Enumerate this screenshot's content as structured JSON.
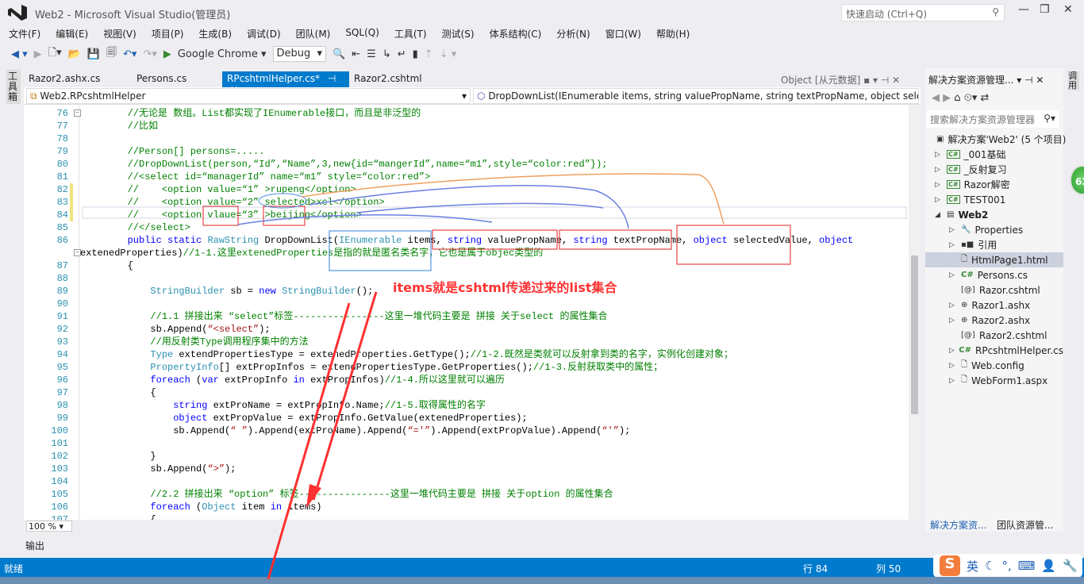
{
  "window": {
    "title": "Web2 - Microsoft Visual Studio(管理员)",
    "quick_launch": "快速启动 (Ctrl+Q)"
  },
  "menu": [
    "文件(F)",
    "编辑(E)",
    "视图(V)",
    "项目(P)",
    "生成(B)",
    "调试(D)",
    "团队(M)",
    "SQL(Q)",
    "工具(T)",
    "测试(S)",
    "体系结构(C)",
    "分析(N)",
    "窗口(W)",
    "帮助(H)"
  ],
  "toolbar": {
    "run_target": "Google Chrome",
    "config": "Debug"
  },
  "left_toolbox": "工具箱",
  "tabs": [
    {
      "label": "Razor2.ashx.cs",
      "active": false
    },
    {
      "label": "Persons.cs",
      "active": false
    },
    {
      "label": "RPcshtmlHelper.cs*",
      "active": true
    },
    {
      "label": "Razor2.cshtml",
      "active": false
    }
  ],
  "object_browser": "Object [从元数据]",
  "nav": {
    "class": "Web2.RPcshtmlHelper",
    "member": "DropDownList(IEnumerable items, string valuePropName, string textPropName, object selectedValue, object extenedProperties)"
  },
  "code": [
    {
      "n": "76",
      "fold": "-",
      "segs": [
        [
          "c",
          "        //无论是 数组。List都实现了IEnumerable接口，而且是非泛型的"
        ]
      ]
    },
    {
      "n": "77",
      "segs": [
        [
          "c",
          "        //比如"
        ]
      ]
    },
    {
      "n": "78",
      "segs": []
    },
    {
      "n": "79",
      "segs": [
        [
          "c",
          "        //Person[] persons=....."
        ]
      ]
    },
    {
      "n": "80",
      "segs": [
        [
          "c",
          "        //DropDownList(person,“Id”,“Name”,3,new{id=“mangerId”,name=“m1”,style=“color:red”});"
        ]
      ]
    },
    {
      "n": "81",
      "segs": [
        [
          "c",
          "        //<select id=“managerId” name=“m1” style=“color:red”>"
        ]
      ]
    },
    {
      "n": "82",
      "chg": true,
      "segs": [
        [
          "c",
          "        //    <option value=“1” >rupeng</option>"
        ]
      ]
    },
    {
      "n": "83",
      "chg": true,
      "segs": [
        [
          "c",
          "        //    <option value=“2” selected>xcl</option>"
        ]
      ]
    },
    {
      "n": "84",
      "chg": true,
      "segs": [
        [
          "c",
          "        //    <option vlaue=“3” >beijing</option>"
        ]
      ]
    },
    {
      "n": "85",
      "segs": [
        [
          "c",
          "        //</select>"
        ]
      ]
    },
    {
      "n": "86",
      "segs": [
        [
          "p",
          "        "
        ],
        [
          "k",
          "public static "
        ],
        [
          "t",
          "RawString"
        ],
        [
          "p",
          " DropDownList("
        ],
        [
          "t",
          "IEnumerable"
        ],
        [
          "p",
          " items, "
        ],
        [
          "k",
          "string"
        ],
        [
          "p",
          " valuePropName, "
        ],
        [
          "k",
          "string"
        ],
        [
          "p",
          " textPropName, "
        ],
        [
          "k",
          "object"
        ],
        [
          "p",
          " selectedValue, "
        ],
        [
          "k",
          "object"
        ]
      ]
    },
    {
      "n": "",
      "fold": "-",
      "wrap": true,
      "segs": [
        [
          "p",
          "extenedProperties)"
        ],
        [
          "c",
          "//1-1.这里extenedProperties是指的就是匿名类名字，它也是属于objec类型的"
        ]
      ]
    },
    {
      "n": "87",
      "segs": [
        [
          "p",
          "        {"
        ]
      ]
    },
    {
      "n": "88",
      "segs": []
    },
    {
      "n": "89",
      "segs": [
        [
          "p",
          "            "
        ],
        [
          "t",
          "StringBuilder"
        ],
        [
          "p",
          " sb = "
        ],
        [
          "k",
          "new "
        ],
        [
          "t",
          "StringBuilder"
        ],
        [
          "p",
          "();"
        ]
      ]
    },
    {
      "n": "90",
      "segs": []
    },
    {
      "n": "91",
      "segs": [
        [
          "c",
          "            //1.1 拼接出来 “select”标签----------------这里一堆代码主要是 拼接 关于select 的属性集合"
        ]
      ]
    },
    {
      "n": "92",
      "segs": [
        [
          "p",
          "            sb.Append("
        ],
        [
          "s",
          "“<select”"
        ],
        [
          "p",
          ");"
        ]
      ]
    },
    {
      "n": "93",
      "segs": [
        [
          "c",
          "            //用反射类Type调用程序集中的方法"
        ]
      ]
    },
    {
      "n": "94",
      "segs": [
        [
          "p",
          "            "
        ],
        [
          "t",
          "Type"
        ],
        [
          "p",
          " extendPropertiesType = extenedProperties.GetType();"
        ],
        [
          "c",
          "//1-2.既然是类就可以反射拿到类的名字，实例化创建对象；"
        ]
      ]
    },
    {
      "n": "95",
      "segs": [
        [
          "p",
          "            "
        ],
        [
          "t",
          "PropertyInfo"
        ],
        [
          "p",
          "[] extPropInfos = extendPropertiesType.GetProperties();"
        ],
        [
          "c",
          "//1-3.反射获取类中的属性；"
        ]
      ]
    },
    {
      "n": "96",
      "segs": [
        [
          "p",
          "            "
        ],
        [
          "k",
          "foreach"
        ],
        [
          "p",
          " ("
        ],
        [
          "k",
          "var"
        ],
        [
          "p",
          " extPropInfo "
        ],
        [
          "k",
          "in"
        ],
        [
          "p",
          " extPropInfos)"
        ],
        [
          "c",
          "//1-4.所以这里就可以遍历"
        ]
      ]
    },
    {
      "n": "97",
      "segs": [
        [
          "p",
          "            {"
        ]
      ]
    },
    {
      "n": "98",
      "segs": [
        [
          "p",
          "                "
        ],
        [
          "k",
          "string"
        ],
        [
          "p",
          " extProName = extPropInfo.Name;"
        ],
        [
          "c",
          "//1-5.取得属性的名字"
        ]
      ]
    },
    {
      "n": "99",
      "segs": [
        [
          "p",
          "                "
        ],
        [
          "k",
          "object"
        ],
        [
          "p",
          " extPropValue = extPropInfo.GetValue(extenedProperties);"
        ]
      ]
    },
    {
      "n": "100",
      "segs": [
        [
          "p",
          "                sb.Append("
        ],
        [
          "s",
          "“ ”"
        ],
        [
          "p",
          ").Append(extProName).Append("
        ],
        [
          "s",
          "“='”"
        ],
        [
          "p",
          ").Append(extPropValue).Append("
        ],
        [
          "s",
          "“'”"
        ],
        [
          "p",
          ");"
        ]
      ]
    },
    {
      "n": "101",
      "segs": []
    },
    {
      "n": "102",
      "segs": [
        [
          "p",
          "            }"
        ]
      ]
    },
    {
      "n": "103",
      "segs": [
        [
          "p",
          "            sb.Append("
        ],
        [
          "s",
          "“>”"
        ],
        [
          "p",
          ");"
        ]
      ]
    },
    {
      "n": "104",
      "segs": []
    },
    {
      "n": "105",
      "segs": [
        [
          "c",
          "            //2.2 拼接出来 “option” 标签----------------这里一堆代码主要是 拼接 关于option 的属性集合"
        ]
      ]
    },
    {
      "n": "106",
      "segs": [
        [
          "p",
          "            "
        ],
        [
          "k",
          "foreach"
        ],
        [
          "p",
          " ("
        ],
        [
          "t",
          "Object"
        ],
        [
          "p",
          " item "
        ],
        [
          "k",
          "in"
        ],
        [
          "p",
          " items)"
        ]
      ]
    },
    {
      "n": "107",
      "segs": [
        [
          "p",
          "            {"
        ]
      ]
    }
  ],
  "annotation": "items就是cshtml传递过来的list集合",
  "zoom": "100 %",
  "output_label": "输出",
  "status": {
    "ready": "就绪",
    "line": "行 84",
    "col": "列 50"
  },
  "ime": {
    "logo": "S",
    "mode": "英"
  },
  "solution": {
    "title": "解决方案资源管理...",
    "search": "搜索解决方案资源管理器",
    "items": [
      {
        "label": "解决方案'Web2' (5 个项目)",
        "level": 0,
        "icon": "solution-icon",
        "tri": ""
      },
      {
        "label": "_001基础",
        "level": 1,
        "icon": "csharp-project-icon",
        "tri": "▷"
      },
      {
        "label": "_反射复习",
        "level": 1,
        "icon": "csharp-project-icon",
        "tri": "▷"
      },
      {
        "label": "Razor解密",
        "level": 1,
        "icon": "csharp-project-icon",
        "tri": "▷"
      },
      {
        "label": "TEST001",
        "level": 1,
        "icon": "csharp-project-icon",
        "tri": "▷"
      },
      {
        "label": "Web2",
        "level": 1,
        "icon": "web-project-icon",
        "tri": "◢",
        "bold": true
      },
      {
        "label": "Properties",
        "level": 2,
        "icon": "wrench-icon",
        "tri": "▷"
      },
      {
        "label": "引用",
        "level": 2,
        "icon": "references-icon",
        "tri": "▷"
      },
      {
        "label": "HtmlPage1.html",
        "level": 2,
        "icon": "html-file-icon",
        "tri": "",
        "selected": true
      },
      {
        "label": "Persons.cs",
        "level": 2,
        "icon": "csharp-file-icon",
        "tri": "▷"
      },
      {
        "label": "Razor.cshtml",
        "level": 2,
        "icon": "razor-file-icon",
        "tri": ""
      },
      {
        "label": "Razor1.ashx",
        "level": 2,
        "icon": "handler-file-icon",
        "tri": "▷"
      },
      {
        "label": "Razor2.ashx",
        "level": 2,
        "icon": "handler-file-icon",
        "tri": "▷"
      },
      {
        "label": "Razor2.cshtml",
        "level": 2,
        "icon": "razor-file-icon",
        "tri": ""
      },
      {
        "label": "RPcshtmlHelper.cs",
        "level": 2,
        "icon": "csharp-file-icon",
        "tri": "▷"
      },
      {
        "label": "Web.config",
        "level": 2,
        "icon": "config-file-icon",
        "tri": "▷"
      },
      {
        "label": "WebForm1.aspx",
        "level": 2,
        "icon": "aspx-file-icon",
        "tri": "▷"
      }
    ],
    "bottom_tabs": [
      "解决方案资...",
      "团队资源管..."
    ]
  },
  "right_strip": "调用",
  "badge": "62",
  "colors": {
    "accent": "#007acc",
    "comment": "#008000",
    "keyword": "#0000ff",
    "type": "#2b91af",
    "string": "#a31515",
    "annotation_red": "#ff3333"
  }
}
